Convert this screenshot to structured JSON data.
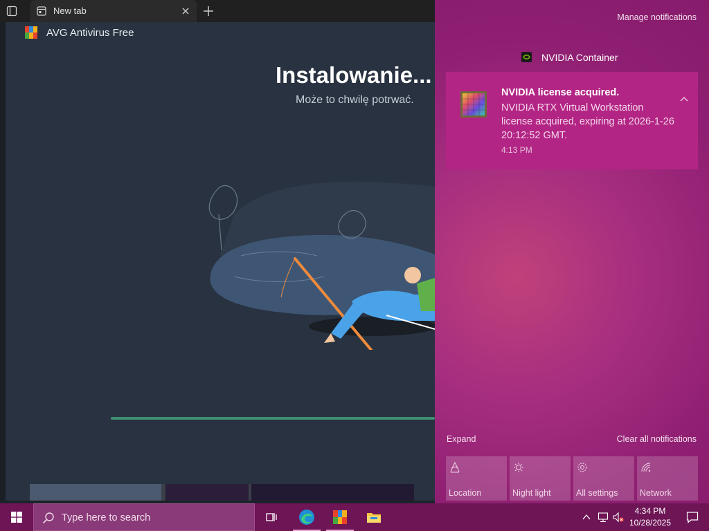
{
  "browser": {
    "tab_label": "New tab"
  },
  "installer": {
    "app_title": "AVG Antivirus Free",
    "heading": "Instalowanie...",
    "subheading": "Może to chwilę potrwać.",
    "progress": 1.0
  },
  "action_center": {
    "manage_label": "Manage notifications",
    "group_title": "NVIDIA Container",
    "toast": {
      "title": "NVIDIA license acquired.",
      "body": "NVIDIA RTX Virtual Workstation license acquired, expiring at 2026-1-26 20:12:52 GMT.",
      "time": "4:13 PM"
    },
    "expand_label": "Expand",
    "clear_label": "Clear all notifications",
    "tiles": [
      {
        "label": "Location",
        "icon": "location-icon"
      },
      {
        "label": "Night light",
        "icon": "night-light-icon"
      },
      {
        "label": "All settings",
        "icon": "gear-icon"
      },
      {
        "label": "Network",
        "icon": "network-icon"
      }
    ]
  },
  "taskbar": {
    "search_placeholder": "Type here to search",
    "apps": [
      "task-view-icon",
      "edge-icon",
      "avg-icon",
      "file-explorer-icon"
    ],
    "time": "4:34 PM",
    "date": "10/28/2025"
  },
  "colors": {
    "accent": "#861b6c",
    "toast_bg": "#b32585",
    "taskbar_bg": "#6e1556",
    "installer_bg": "#283240"
  }
}
